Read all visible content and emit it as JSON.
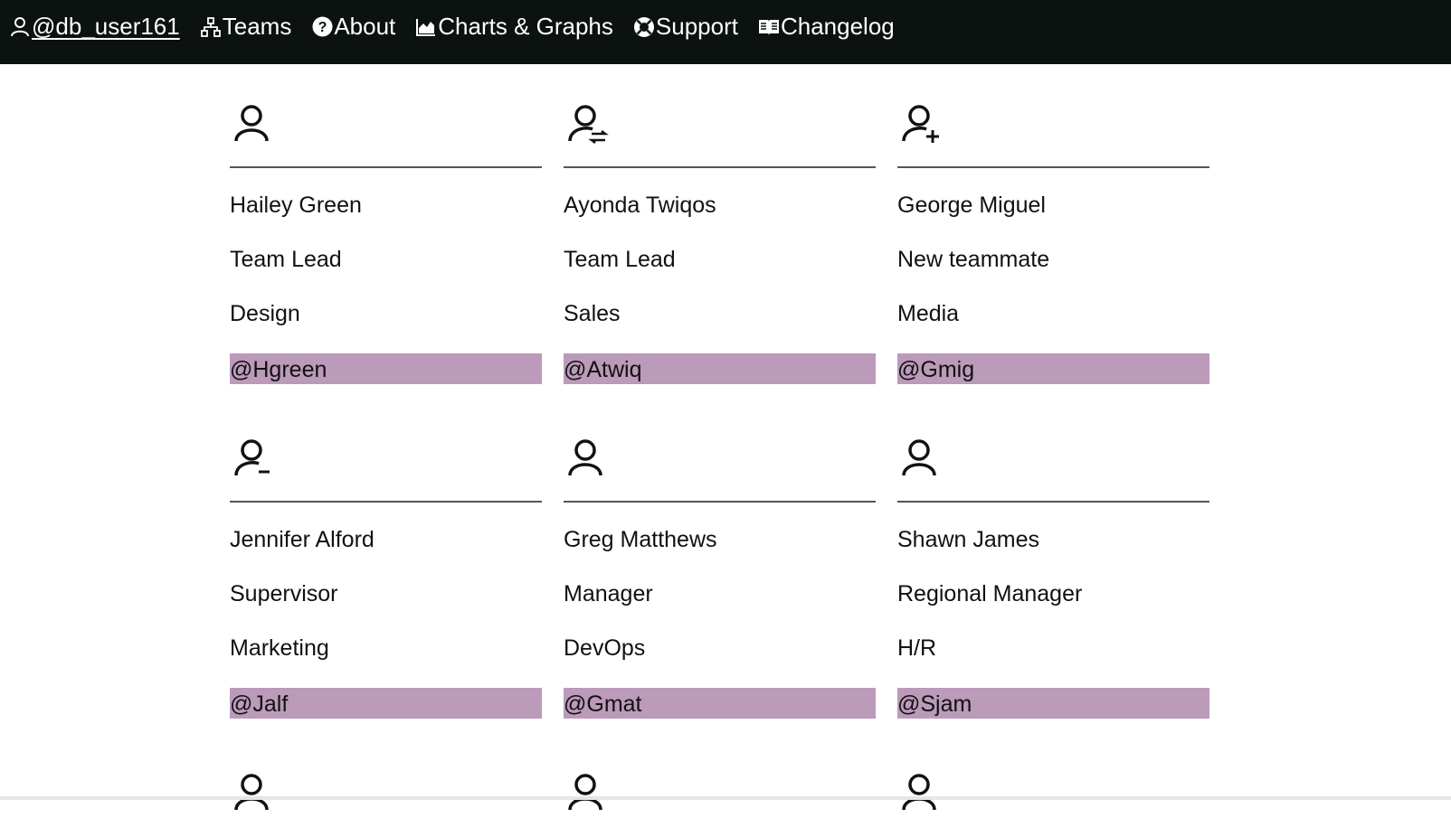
{
  "nav": {
    "user": {
      "label": "@db_user161",
      "icon": "user-icon"
    },
    "items": [
      {
        "label": "Teams",
        "icon": "sitemap-icon"
      },
      {
        "label": "About",
        "icon": "question-circle-icon"
      },
      {
        "label": "Charts & Graphs",
        "icon": "area-chart-icon"
      },
      {
        "label": "Support",
        "icon": "lifebuoy-icon"
      },
      {
        "label": "Changelog",
        "icon": "open-book-icon"
      }
    ]
  },
  "people": [
    {
      "name": "Hailey Green",
      "role": "Team Lead",
      "department": "Design",
      "handle": "@Hgreen",
      "icon": "user-icon"
    },
    {
      "name": "Ayonda Twiqos",
      "role": "Team Lead",
      "department": "Sales",
      "handle": "@Atwiq",
      "icon": "user-swap-icon"
    },
    {
      "name": "George Miguel",
      "role": "New teammate",
      "department": "Media",
      "handle": "@Gmig",
      "icon": "user-plus-icon"
    },
    {
      "name": "Jennifer Alford",
      "role": "Supervisor",
      "department": "Marketing",
      "handle": "@Jalf",
      "icon": "user-minus-icon"
    },
    {
      "name": "Greg Matthews",
      "role": "Manager",
      "department": "DevOps",
      "handle": "@Gmat",
      "icon": "user-icon"
    },
    {
      "name": "Shawn James",
      "role": "Regional Manager",
      "department": "H/R",
      "handle": "@Sjam",
      "icon": "user-icon"
    }
  ],
  "colors": {
    "topbar": "#0c120f",
    "handle_bg": "#bb9aba"
  }
}
